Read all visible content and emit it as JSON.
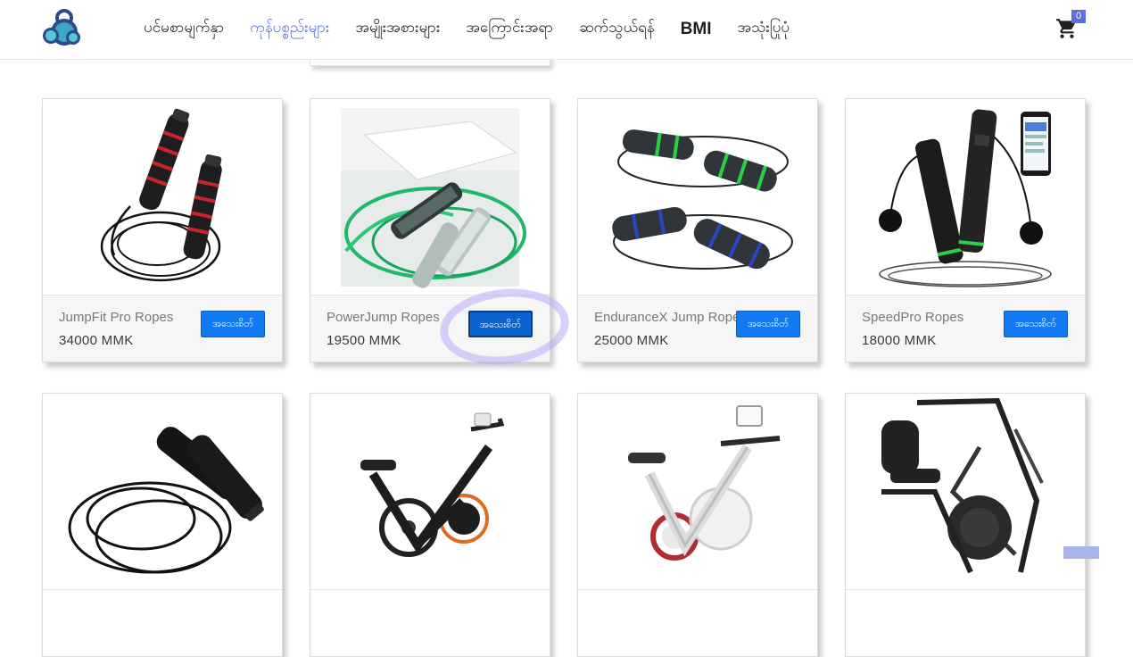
{
  "nav": {
    "items": [
      {
        "label": "ပင်မစာမျက်နှာ",
        "active": false,
        "bold": false
      },
      {
        "label": "ကုန်ပစ္စည်းများ",
        "active": true,
        "bold": false
      },
      {
        "label": "အမျိုးအစားများ",
        "active": false,
        "bold": false
      },
      {
        "label": "အကြောင်းအရာ",
        "active": false,
        "bold": false
      },
      {
        "label": "ဆက်သွယ်ရန်",
        "active": false,
        "bold": false
      },
      {
        "label": "BMI",
        "active": false,
        "bold": true
      },
      {
        "label": "အသုံးပြုပုံ",
        "active": false,
        "bold": false
      }
    ],
    "cart_count": "0"
  },
  "colors": {
    "accent": "#5b6fe0",
    "button": "#1179f2",
    "text": "#1d1d1d"
  },
  "order_button_label": "အသေးစိတ်",
  "products": [
    {
      "name": "JumpFit Pro Ropes",
      "price": "34000 MMK",
      "icon": "jump-rope-red-image"
    },
    {
      "name": "PowerJump Ropes",
      "price": "19500 MMK",
      "icon": "jump-rope-green-photo"
    },
    {
      "name": "EnduranceX Jump Ropes",
      "price": "25000 MMK",
      "icon": "jump-rope-green-blue-image"
    },
    {
      "name": "SpeedPro Ropes",
      "price": "18000 MMK",
      "icon": "smart-jump-rope-image"
    },
    {
      "name": "",
      "price": "",
      "icon": "jump-rope-black-image"
    },
    {
      "name": "",
      "price": "",
      "icon": "exercise-bike-orange-image"
    },
    {
      "name": "",
      "price": "",
      "icon": "exercise-bike-white-image"
    },
    {
      "name": "",
      "price": "",
      "icon": "recumbent-bike-image"
    }
  ]
}
